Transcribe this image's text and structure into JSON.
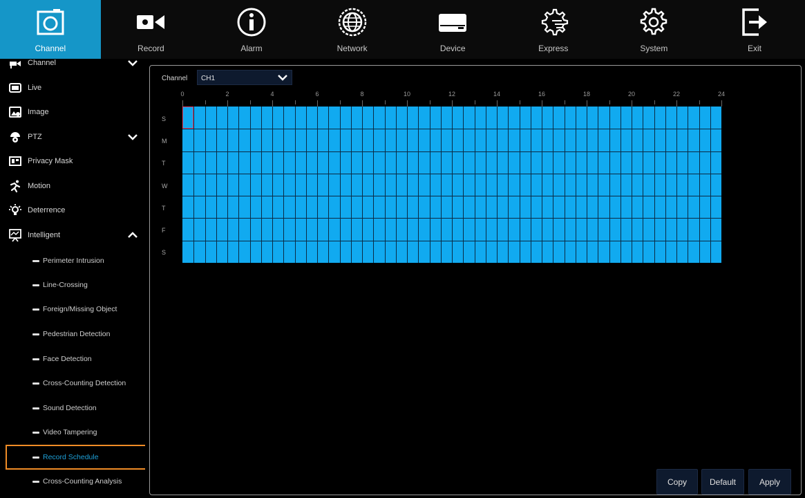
{
  "topbar": {
    "items": [
      {
        "label": "Channel",
        "icon": "camera-icon",
        "active": true
      },
      {
        "label": "Record",
        "icon": "video-camera-icon"
      },
      {
        "label": "Alarm",
        "icon": "info-circle-icon"
      },
      {
        "label": "Network",
        "icon": "globe-icon"
      },
      {
        "label": "Device",
        "icon": "hard-drive-icon"
      },
      {
        "label": "Express",
        "icon": "gear-hand-icon"
      },
      {
        "label": "System",
        "icon": "gear-icon"
      },
      {
        "label": "Exit",
        "icon": "exit-icon"
      }
    ]
  },
  "sidebar": {
    "items": [
      {
        "label": "Channel",
        "icon": "channel-icon",
        "chevron": "down"
      },
      {
        "label": "Live",
        "icon": "monitor-icon"
      },
      {
        "label": "Image",
        "icon": "image-icon"
      },
      {
        "label": "PTZ",
        "icon": "ptz-camera-icon",
        "chevron": "down"
      },
      {
        "label": "Privacy Mask",
        "icon": "privacy-mask-icon"
      },
      {
        "label": "Motion",
        "icon": "running-person-icon"
      },
      {
        "label": "Deterrence",
        "icon": "light-bulb-icon"
      },
      {
        "label": "Intelligent",
        "icon": "intelligent-icon",
        "chevron": "up"
      }
    ],
    "subitems": [
      {
        "label": "Perimeter Intrusion"
      },
      {
        "label": "Line-Crossing"
      },
      {
        "label": "Foreign/Missing Object"
      },
      {
        "label": "Pedestrian Detection"
      },
      {
        "label": "Face Detection"
      },
      {
        "label": "Cross-Counting Detection"
      },
      {
        "label": "Sound Detection"
      },
      {
        "label": "Video Tampering"
      },
      {
        "label": "Record Schedule",
        "selected": true
      },
      {
        "label": "Cross-Counting Analysis"
      }
    ]
  },
  "schedule": {
    "channel_label": "Channel",
    "channel_value": "CH1",
    "hour_labels": [
      "0",
      "2",
      "4",
      "6",
      "8",
      "10",
      "12",
      "14",
      "16",
      "18",
      "20",
      "22",
      "24"
    ],
    "day_labels": [
      "S",
      "M",
      "T",
      "W",
      "T",
      "F",
      "S"
    ],
    "fill_color": "#11aaf0",
    "selection_color": "#e0426a"
  },
  "buttons": {
    "copy": "Copy",
    "default": "Default",
    "apply": "Apply"
  },
  "colors": {
    "accent": "#1596c8",
    "selected_border": "#f08c26",
    "selected_text": "#1ea0d8"
  }
}
